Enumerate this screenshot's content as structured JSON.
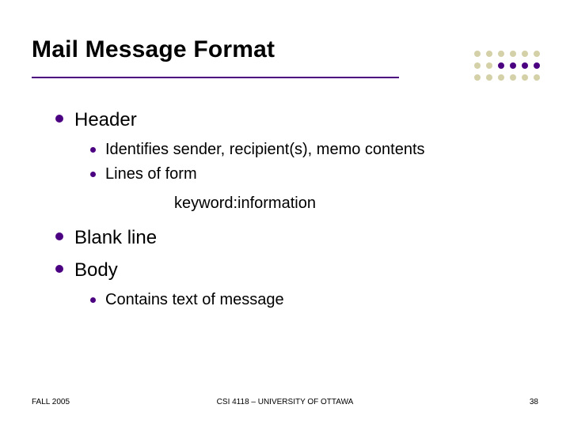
{
  "title": "Mail Message Format",
  "bullets": {
    "header": {
      "label": "Header",
      "sub1": "Identifies sender, recipient(s), memo contents",
      "sub2": "Lines of form",
      "kwinfo": "keyword:information"
    },
    "blankline": {
      "label": "Blank line"
    },
    "body": {
      "label": "Body",
      "sub1": "Contains text of message"
    }
  },
  "footer": {
    "left": "FALL 2005",
    "center": "CSI 4118 – UNIVERSITY OF OTTAWA",
    "right": "38"
  },
  "dots": {
    "colors_row1": [
      "#D4D0A8",
      "#D4D0A8",
      "#D4D0A8",
      "#D4D0A8",
      "#D4D0A8",
      "#D4D0A8"
    ],
    "colors_row2": [
      "#D4D0A8",
      "#D4D0A8",
      "#4B0082",
      "#4B0082",
      "#4B0082",
      "#4B0082"
    ],
    "colors_row3": [
      "#D4D0A8",
      "#D4D0A8",
      "#D4D0A8",
      "#D4D0A8",
      "#D4D0A8",
      "#D4D0A8"
    ]
  }
}
